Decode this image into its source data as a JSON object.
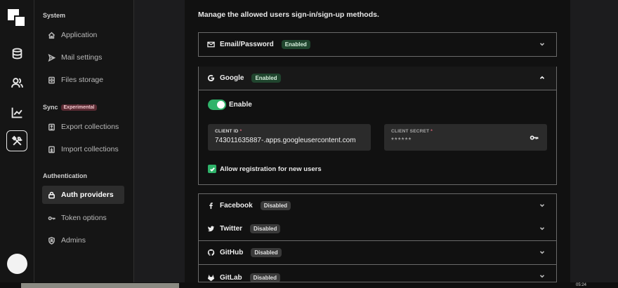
{
  "rail": {
    "items": [
      {
        "name": "database-icon"
      },
      {
        "name": "users-icon"
      },
      {
        "name": "chart-icon"
      },
      {
        "name": "tools-icon",
        "active": true
      }
    ]
  },
  "sidebar": {
    "system_title": "System",
    "system_items": [
      "Application",
      "Mail settings",
      "Files storage"
    ],
    "sync_title": "Sync",
    "sync_badge": "Experimental",
    "sync_items": [
      "Export collections",
      "Import collections"
    ],
    "auth_title": "Authentication",
    "auth_items": [
      "Auth providers",
      "Token options",
      "Admins"
    ],
    "active_item": "Auth providers"
  },
  "main": {
    "intro": "Manage the allowed users sign-in/sign-up methods.",
    "providers": [
      {
        "name": "Email/Password",
        "status": "Enabled",
        "icon": "mail-icon"
      },
      {
        "name": "Google",
        "status": "Enabled",
        "icon": "google-icon",
        "expanded": true
      },
      {
        "name": "Facebook",
        "status": "Disabled",
        "icon": "facebook-icon"
      },
      {
        "name": "Twitter",
        "status": "Disabled",
        "icon": "twitter-icon"
      },
      {
        "name": "GitHub",
        "status": "Disabled",
        "icon": "github-icon"
      },
      {
        "name": "GitLab",
        "status": "Disabled",
        "icon": "gitlab-icon"
      }
    ],
    "google": {
      "enable_label": "Enable",
      "client_id_label": "CLIENT ID",
      "client_id_value": "743011635887-.apps.googleusercontent.com",
      "client_secret_label": "CLIENT SECRET",
      "client_secret_value": "******",
      "allow_registration_label": "Allow registration for new users"
    }
  },
  "taskbar": {
    "time": "05:24"
  },
  "colors": {
    "accent_green": "#2fb36a",
    "enabled_badge": "#20452e",
    "disabled_badge": "#3a3a3a",
    "required_star": "#e5677a"
  }
}
